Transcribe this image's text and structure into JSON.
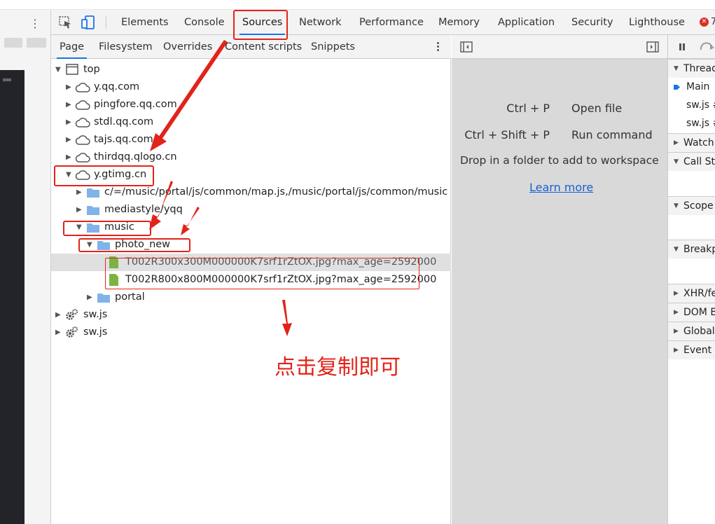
{
  "devtools": {
    "tabs": [
      {
        "label": "Elements"
      },
      {
        "label": "Console"
      },
      {
        "label": "Sources"
      },
      {
        "label": "Network"
      },
      {
        "label": "Performance"
      },
      {
        "label": "Memory"
      },
      {
        "label": "Application"
      },
      {
        "label": "Security"
      },
      {
        "label": "Lighthouse"
      }
    ],
    "active_tab": "Sources",
    "error_count": "7"
  },
  "navigator": {
    "subtabs": [
      {
        "label": "Page"
      },
      {
        "label": "Filesystem"
      },
      {
        "label": "Overrides"
      },
      {
        "label": "Content scripts"
      },
      {
        "label": "Snippets"
      }
    ],
    "active_subtab": "Page",
    "tree": [
      {
        "label": "top",
        "type": "frame",
        "expanded": true
      },
      {
        "label": "y.qq.com",
        "type": "domain"
      },
      {
        "label": "pingfore.qq.com",
        "type": "domain"
      },
      {
        "label": "stdl.qq.com",
        "type": "domain"
      },
      {
        "label": "tajs.qq.com",
        "type": "domain"
      },
      {
        "label": "thirdqq.qlogo.cn",
        "type": "domain"
      },
      {
        "label": "y.gtimg.cn",
        "type": "domain",
        "expanded": true
      },
      {
        "label": "c/=/music/portal/js/common/map.js,/music/portal/js/common/music",
        "type": "folder"
      },
      {
        "label": "mediastyle/yqq",
        "type": "folder"
      },
      {
        "label": "music",
        "type": "folder",
        "expanded": true
      },
      {
        "label": "photo_new",
        "type": "folder",
        "expanded": true
      },
      {
        "label": "T002R300x300M000000K7srf1rZtOX.jpg?max_age=2592000",
        "type": "file",
        "selected": true
      },
      {
        "label": "T002R800x800M000000K7srf1rZtOX.jpg?max_age=2592000",
        "type": "file"
      },
      {
        "label": "portal",
        "type": "folder"
      },
      {
        "label": "sw.js",
        "type": "worker"
      },
      {
        "label": "sw.js",
        "type": "worker"
      }
    ]
  },
  "editor": {
    "shortcuts": [
      {
        "keys": "Ctrl + P",
        "action": "Open file"
      },
      {
        "keys": "Ctrl + Shift + P",
        "action": "Run command"
      }
    ],
    "drop_hint": "Drop in a folder to add to workspace",
    "learn_more": "Learn more"
  },
  "debugger": {
    "threads_label": "Threads",
    "threads": [
      {
        "label": "Main",
        "current": true
      },
      {
        "label": "sw.js #"
      },
      {
        "label": "sw.js #"
      }
    ],
    "sections": [
      {
        "label": "Watch"
      },
      {
        "label": "Call Stack"
      },
      {
        "label": "Scope"
      },
      {
        "label": "Breakpoints"
      },
      {
        "label": "XHR/fetch Breakpoints"
      },
      {
        "label": "DOM Breakpoints"
      },
      {
        "label": "Global Listeners"
      },
      {
        "label": "Event Listener Breakpoints"
      }
    ]
  },
  "annotation": {
    "text": "点击复制即可",
    "color": "#e2231a"
  },
  "colors": {
    "accent": "#1a73e8",
    "link": "#1a5fd4",
    "folder": "#7fb3ea",
    "file": "#7cb342"
  }
}
